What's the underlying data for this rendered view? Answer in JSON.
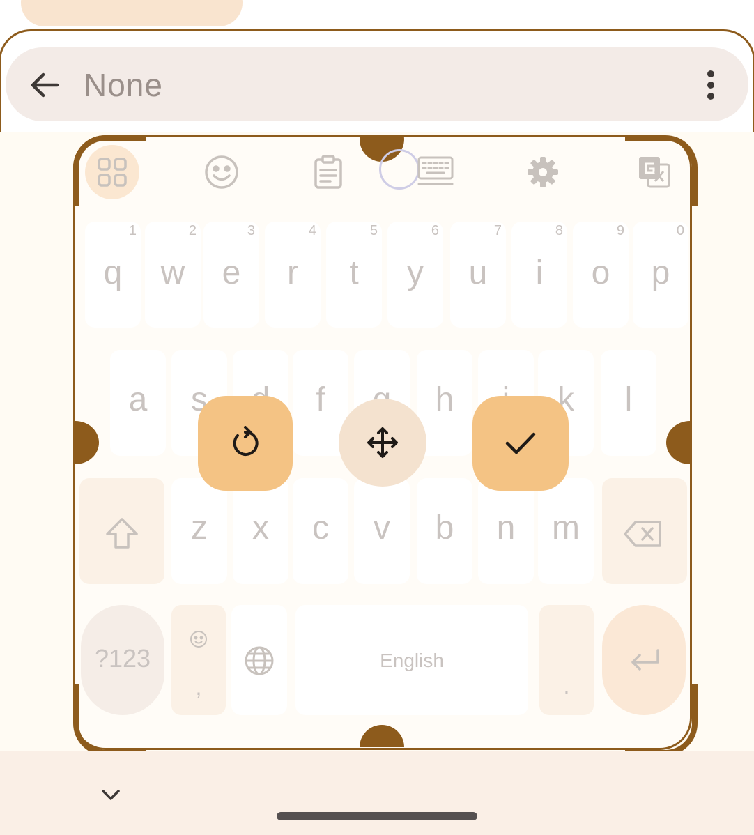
{
  "search": {
    "text": "None"
  },
  "keyboard": {
    "row1": [
      {
        "key": "q",
        "hint": "1"
      },
      {
        "key": "w",
        "hint": "2"
      },
      {
        "key": "e",
        "hint": "3"
      },
      {
        "key": "r",
        "hint": "4"
      },
      {
        "key": "t",
        "hint": "5"
      },
      {
        "key": "y",
        "hint": "6"
      },
      {
        "key": "u",
        "hint": "7"
      },
      {
        "key": "i",
        "hint": "8"
      },
      {
        "key": "o",
        "hint": "9"
      },
      {
        "key": "p",
        "hint": "0"
      }
    ],
    "row2": [
      "a",
      "s",
      "d",
      "f",
      "g",
      "h",
      "j",
      "k",
      "l"
    ],
    "row3": [
      "z",
      "x",
      "c",
      "v",
      "b",
      "n",
      "m"
    ],
    "symbols_label": "?123",
    "comma_label": ",",
    "space_label": "English",
    "period_label": "."
  },
  "icons": {
    "back": "arrow-left-icon",
    "menu": "more-vert-icon",
    "apps": "grid-icon",
    "emoji": "emoji-icon",
    "clipboard": "clipboard-icon",
    "keyboard": "keyboard-icon",
    "settings": "gear-icon",
    "translate": "translate-icon",
    "reset": "reset-icon",
    "move": "move-icon",
    "done": "check-icon",
    "shift": "shift-icon",
    "backspace": "backspace-icon",
    "globe": "globe-icon",
    "enter": "enter-icon",
    "nav_down": "chevron-down-icon"
  },
  "colors": {
    "accent": "#8d5b1c",
    "control": "#f4c384",
    "background": "#fffcf7"
  }
}
